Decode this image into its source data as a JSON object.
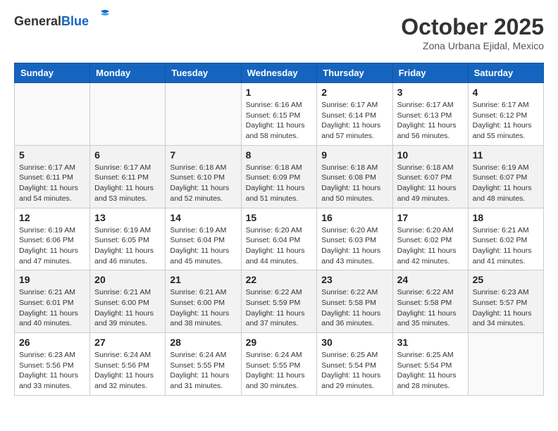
{
  "header": {
    "logo_general": "General",
    "logo_blue": "Blue",
    "month_title": "October 2025",
    "subtitle": "Zona Urbana Ejidal, Mexico"
  },
  "weekdays": [
    "Sunday",
    "Monday",
    "Tuesday",
    "Wednesday",
    "Thursday",
    "Friday",
    "Saturday"
  ],
  "weeks": [
    {
      "alt": false,
      "days": [
        {
          "num": "",
          "info": ""
        },
        {
          "num": "",
          "info": ""
        },
        {
          "num": "",
          "info": ""
        },
        {
          "num": "1",
          "info": "Sunrise: 6:16 AM\nSunset: 6:15 PM\nDaylight: 11 hours\nand 58 minutes."
        },
        {
          "num": "2",
          "info": "Sunrise: 6:17 AM\nSunset: 6:14 PM\nDaylight: 11 hours\nand 57 minutes."
        },
        {
          "num": "3",
          "info": "Sunrise: 6:17 AM\nSunset: 6:13 PM\nDaylight: 11 hours\nand 56 minutes."
        },
        {
          "num": "4",
          "info": "Sunrise: 6:17 AM\nSunset: 6:12 PM\nDaylight: 11 hours\nand 55 minutes."
        }
      ]
    },
    {
      "alt": true,
      "days": [
        {
          "num": "5",
          "info": "Sunrise: 6:17 AM\nSunset: 6:11 PM\nDaylight: 11 hours\nand 54 minutes."
        },
        {
          "num": "6",
          "info": "Sunrise: 6:17 AM\nSunset: 6:11 PM\nDaylight: 11 hours\nand 53 minutes."
        },
        {
          "num": "7",
          "info": "Sunrise: 6:18 AM\nSunset: 6:10 PM\nDaylight: 11 hours\nand 52 minutes."
        },
        {
          "num": "8",
          "info": "Sunrise: 6:18 AM\nSunset: 6:09 PM\nDaylight: 11 hours\nand 51 minutes."
        },
        {
          "num": "9",
          "info": "Sunrise: 6:18 AM\nSunset: 6:08 PM\nDaylight: 11 hours\nand 50 minutes."
        },
        {
          "num": "10",
          "info": "Sunrise: 6:18 AM\nSunset: 6:07 PM\nDaylight: 11 hours\nand 49 minutes."
        },
        {
          "num": "11",
          "info": "Sunrise: 6:19 AM\nSunset: 6:07 PM\nDaylight: 11 hours\nand 48 minutes."
        }
      ]
    },
    {
      "alt": false,
      "days": [
        {
          "num": "12",
          "info": "Sunrise: 6:19 AM\nSunset: 6:06 PM\nDaylight: 11 hours\nand 47 minutes."
        },
        {
          "num": "13",
          "info": "Sunrise: 6:19 AM\nSunset: 6:05 PM\nDaylight: 11 hours\nand 46 minutes."
        },
        {
          "num": "14",
          "info": "Sunrise: 6:19 AM\nSunset: 6:04 PM\nDaylight: 11 hours\nand 45 minutes."
        },
        {
          "num": "15",
          "info": "Sunrise: 6:20 AM\nSunset: 6:04 PM\nDaylight: 11 hours\nand 44 minutes."
        },
        {
          "num": "16",
          "info": "Sunrise: 6:20 AM\nSunset: 6:03 PM\nDaylight: 11 hours\nand 43 minutes."
        },
        {
          "num": "17",
          "info": "Sunrise: 6:20 AM\nSunset: 6:02 PM\nDaylight: 11 hours\nand 42 minutes."
        },
        {
          "num": "18",
          "info": "Sunrise: 6:21 AM\nSunset: 6:02 PM\nDaylight: 11 hours\nand 41 minutes."
        }
      ]
    },
    {
      "alt": true,
      "days": [
        {
          "num": "19",
          "info": "Sunrise: 6:21 AM\nSunset: 6:01 PM\nDaylight: 11 hours\nand 40 minutes."
        },
        {
          "num": "20",
          "info": "Sunrise: 6:21 AM\nSunset: 6:00 PM\nDaylight: 11 hours\nand 39 minutes."
        },
        {
          "num": "21",
          "info": "Sunrise: 6:21 AM\nSunset: 6:00 PM\nDaylight: 11 hours\nand 38 minutes."
        },
        {
          "num": "22",
          "info": "Sunrise: 6:22 AM\nSunset: 5:59 PM\nDaylight: 11 hours\nand 37 minutes."
        },
        {
          "num": "23",
          "info": "Sunrise: 6:22 AM\nSunset: 5:58 PM\nDaylight: 11 hours\nand 36 minutes."
        },
        {
          "num": "24",
          "info": "Sunrise: 6:22 AM\nSunset: 5:58 PM\nDaylight: 11 hours\nand 35 minutes."
        },
        {
          "num": "25",
          "info": "Sunrise: 6:23 AM\nSunset: 5:57 PM\nDaylight: 11 hours\nand 34 minutes."
        }
      ]
    },
    {
      "alt": false,
      "days": [
        {
          "num": "26",
          "info": "Sunrise: 6:23 AM\nSunset: 5:56 PM\nDaylight: 11 hours\nand 33 minutes."
        },
        {
          "num": "27",
          "info": "Sunrise: 6:24 AM\nSunset: 5:56 PM\nDaylight: 11 hours\nand 32 minutes."
        },
        {
          "num": "28",
          "info": "Sunrise: 6:24 AM\nSunset: 5:55 PM\nDaylight: 11 hours\nand 31 minutes."
        },
        {
          "num": "29",
          "info": "Sunrise: 6:24 AM\nSunset: 5:55 PM\nDaylight: 11 hours\nand 30 minutes."
        },
        {
          "num": "30",
          "info": "Sunrise: 6:25 AM\nSunset: 5:54 PM\nDaylight: 11 hours\nand 29 minutes."
        },
        {
          "num": "31",
          "info": "Sunrise: 6:25 AM\nSunset: 5:54 PM\nDaylight: 11 hours\nand 28 minutes."
        },
        {
          "num": "",
          "info": ""
        }
      ]
    }
  ]
}
